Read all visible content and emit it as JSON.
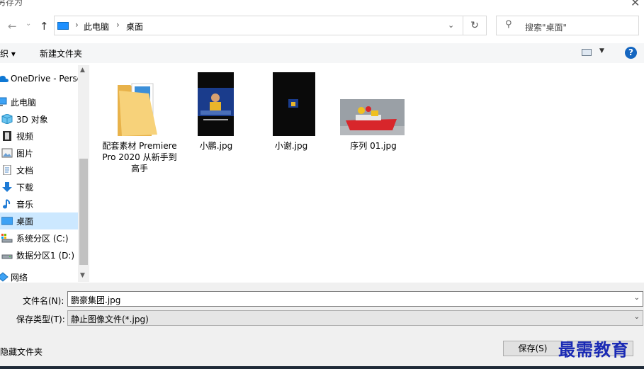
{
  "window": {
    "title": "另存为",
    "close_glyph": "✕"
  },
  "nav_bar": {
    "back_glyph": "←",
    "forward_glyph": "→",
    "recent_glyph": "⌄",
    "up_glyph": "↑",
    "breadcrumbs": [
      "此电脑",
      "桌面"
    ],
    "separator": "›",
    "dropdown_glyph": "⌄",
    "refresh_glyph": "↻",
    "search_icon_glyph": "⚲",
    "search_placeholder": "搜索\"桌面\""
  },
  "toolbar": {
    "organize_label": "织 ▾",
    "new_folder_label": "新建文件夹",
    "help_label": "?",
    "view_dd_glyph": "▼"
  },
  "sidebar": {
    "items": [
      {
        "label": "OneDrive - Perso",
        "icon": "cloud-icon"
      },
      {
        "label": "此电脑",
        "icon": "computer-icon"
      },
      {
        "label": "3D 对象",
        "icon": "cube-icon"
      },
      {
        "label": "视频",
        "icon": "film-icon"
      },
      {
        "label": "图片",
        "icon": "picture-icon"
      },
      {
        "label": "文档",
        "icon": "document-icon"
      },
      {
        "label": "下载",
        "icon": "download-icon"
      },
      {
        "label": "音乐",
        "icon": "music-icon"
      },
      {
        "label": "桌面",
        "icon": "desktop-icon",
        "selected": true
      },
      {
        "label": "系统分区 (C:)",
        "icon": "drive-icon"
      },
      {
        "label": "数据分区1 (D:)",
        "icon": "drive-icon"
      },
      {
        "label": "网络",
        "icon": "network-icon"
      }
    ],
    "scroll_up_glyph": "▲",
    "scroll_down_glyph": "▼"
  },
  "files": [
    {
      "name": "配套素材 Premiere Pro 2020 从新手到高手",
      "type": "folder"
    },
    {
      "name": "小鹏.jpg",
      "type": "image"
    },
    {
      "name": "小谢.jpg",
      "type": "image"
    },
    {
      "name": "序列 01.jpg",
      "type": "image"
    }
  ],
  "form": {
    "filename_label": "文件名(N):",
    "filename_value": "鹏豪集团.jpg",
    "filetype_label": "保存类型(T):",
    "filetype_value": "静止图像文件(*.jpg)",
    "dropdown_glyph": "⌄",
    "hide_folders_label": "隐藏文件夹",
    "save_label": "保存(S)"
  },
  "watermark": "最需教育",
  "colors": {
    "accent": "#1e90ff",
    "selected": "#cce8ff",
    "panel": "#f0f0f0"
  }
}
